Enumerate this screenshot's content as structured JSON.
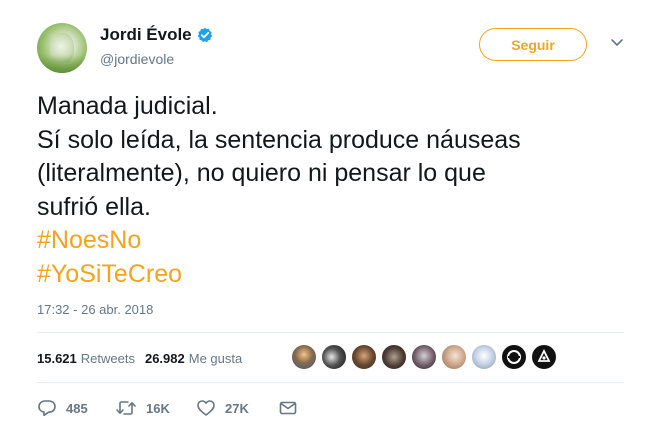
{
  "author": {
    "name": "Jordi Évole",
    "handle": "@jordievole",
    "verified": true
  },
  "follow_button": {
    "label": "Seguir"
  },
  "tweet": {
    "lines": [
      "Manada judicial.",
      "Sí solo leída, la sentencia produce náuseas",
      "(literalmente), no quiero ni pensar lo que",
      "sufrió ella."
    ],
    "hashtags": [
      "#NoesNo",
      "#YoSiTeCreo"
    ],
    "timestamp": "17:32 - 26 abr. 2018"
  },
  "stats": {
    "retweets_count": "15.621",
    "retweets_label": "Retweets",
    "likes_count": "26.982",
    "likes_label": "Me gusta"
  },
  "actions": {
    "replies": "485",
    "retweets": "16K",
    "likes": "27K"
  },
  "colors": {
    "accent": "#f5a31c",
    "verified": "#1da1f2",
    "muted": "#657786",
    "text": "#14171a"
  },
  "icons": [
    "verified-badge-icon",
    "chevron-down-icon",
    "reply-icon",
    "retweet-icon",
    "heart-icon",
    "envelope-icon"
  ]
}
